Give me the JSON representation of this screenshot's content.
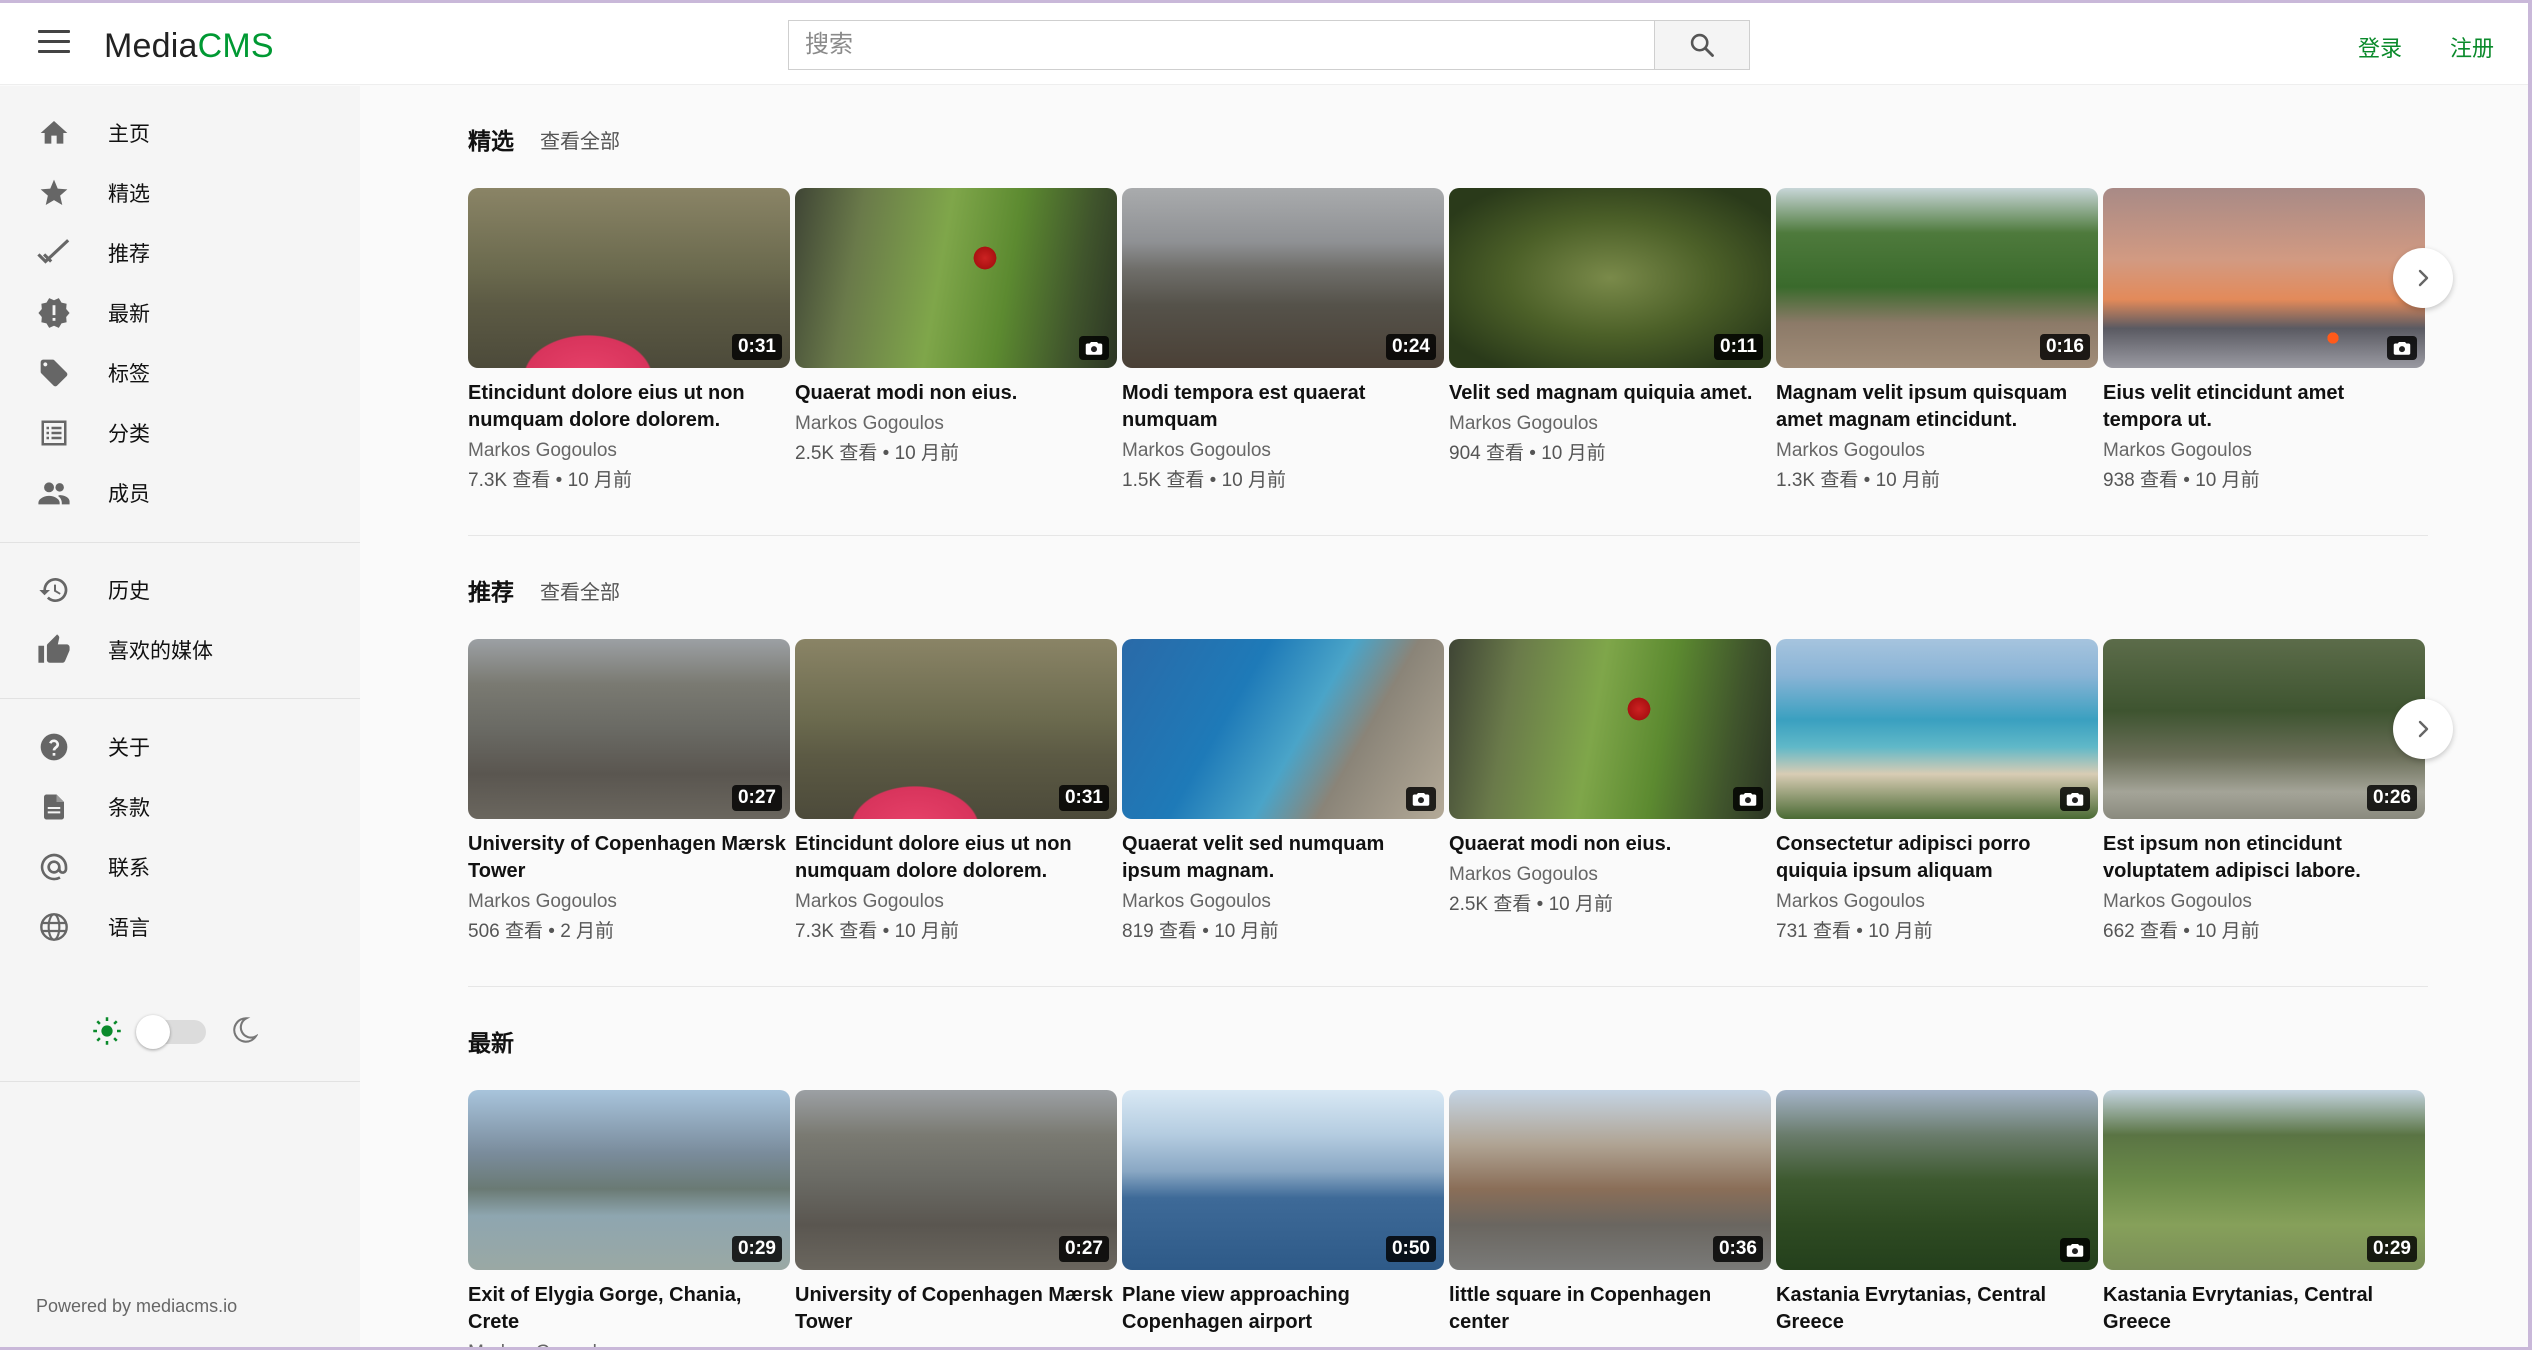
{
  "header": {
    "logo_part1": "Media",
    "logo_part2": "CMS",
    "search_placeholder": "搜索",
    "login": "登录",
    "register": "注册"
  },
  "sidebar": {
    "items": [
      {
        "label": "主页",
        "icon": "home-icon"
      },
      {
        "label": "精选",
        "icon": "star-icon"
      },
      {
        "label": "推荐",
        "icon": "check-icon"
      },
      {
        "label": "最新",
        "icon": "new-badge-icon"
      },
      {
        "label": "标签",
        "icon": "tag-icon"
      },
      {
        "label": "分类",
        "icon": "list-icon"
      },
      {
        "label": "成员",
        "icon": "people-icon"
      }
    ],
    "items2": [
      {
        "label": "历史",
        "icon": "history-icon"
      },
      {
        "label": "喜欢的媒体",
        "icon": "thumbs-up-icon"
      }
    ],
    "items3": [
      {
        "label": "关于",
        "icon": "help-icon"
      },
      {
        "label": "条款",
        "icon": "document-icon"
      },
      {
        "label": "联系",
        "icon": "at-icon"
      },
      {
        "label": "语言",
        "icon": "globe-icon"
      }
    ],
    "powered": "Powered by mediacms.io"
  },
  "sections": [
    {
      "title": "精选",
      "view_all": "查看全部",
      "cards": [
        {
          "title": "Etincidunt dolore eius ut non numquam dolore dolorem.",
          "author": "Markos Gogoulos",
          "meta": "7.3K 查看 • 10 月前",
          "badge": "0:31"
        },
        {
          "title": "Quaerat modi non eius.",
          "author": "Markos Gogoulos",
          "meta": "2.5K 查看 • 10 月前",
          "badge": ""
        },
        {
          "title": "Modi tempora est quaerat numquam",
          "author": "Markos Gogoulos",
          "meta": "1.5K 查看 • 10 月前",
          "badge": "0:24"
        },
        {
          "title": "Velit sed magnam quiquia amet.",
          "author": "Markos Gogoulos",
          "meta": "904 查看 • 10 月前",
          "badge": "0:11"
        },
        {
          "title": "Magnam velit ipsum quisquam amet magnam etincidunt.",
          "author": "Markos Gogoulos",
          "meta": "1.3K 查看 • 10 月前",
          "badge": "0:16"
        },
        {
          "title": "Eius velit etincidunt amet tempora ut.",
          "author": "Markos Gogoulos",
          "meta": "938 查看 • 10 月前",
          "badge": ""
        }
      ]
    },
    {
      "title": "推荐",
      "view_all": "查看全部",
      "cards": [
        {
          "title": "University of Copenhagen Mærsk Tower",
          "author": "Markos Gogoulos",
          "meta": "506 查看 • 2 月前",
          "badge": "0:27"
        },
        {
          "title": "Etincidunt dolore eius ut non numquam dolore dolorem.",
          "author": "Markos Gogoulos",
          "meta": "7.3K 查看 • 10 月前",
          "badge": "0:31"
        },
        {
          "title": "Quaerat velit sed numquam ipsum magnam.",
          "author": "Markos Gogoulos",
          "meta": "819 查看 • 10 月前",
          "badge": ""
        },
        {
          "title": "Quaerat modi non eius.",
          "author": "Markos Gogoulos",
          "meta": "2.5K 查看 • 10 月前",
          "badge": ""
        },
        {
          "title": "Consectetur adipisci porro quiquia ipsum aliquam etincidun…",
          "author": "Markos Gogoulos",
          "meta": "731 查看 • 10 月前",
          "badge": ""
        },
        {
          "title": "Est ipsum non etincidunt voluptatem adipisci labore.",
          "author": "Markos Gogoulos",
          "meta": "662 查看 • 10 月前",
          "badge": "0:26"
        }
      ]
    },
    {
      "title": "最新",
      "view_all": "",
      "cards": [
        {
          "title": "Exit of Elygia Gorge, Chania, Crete",
          "author": "Markos Gogoulos",
          "meta": "",
          "badge": "0:29"
        },
        {
          "title": "University of Copenhagen Mærsk Tower",
          "author": "",
          "meta": "",
          "badge": "0:27"
        },
        {
          "title": "Plane view approaching Copenhagen airport",
          "author": "",
          "meta": "",
          "badge": "0:50"
        },
        {
          "title": "little square in Copenhagen center",
          "author": "",
          "meta": "",
          "badge": "0:36"
        },
        {
          "title": "Kastania Evrytanias, Central Greece",
          "author": "",
          "meta": "",
          "badge": ""
        },
        {
          "title": "Kastania Evrytanias, Central Greece",
          "author": "",
          "meta": "",
          "badge": "0:29"
        }
      ]
    }
  ],
  "colors": {
    "brand": "#009933",
    "link": "#0a8a2b"
  }
}
